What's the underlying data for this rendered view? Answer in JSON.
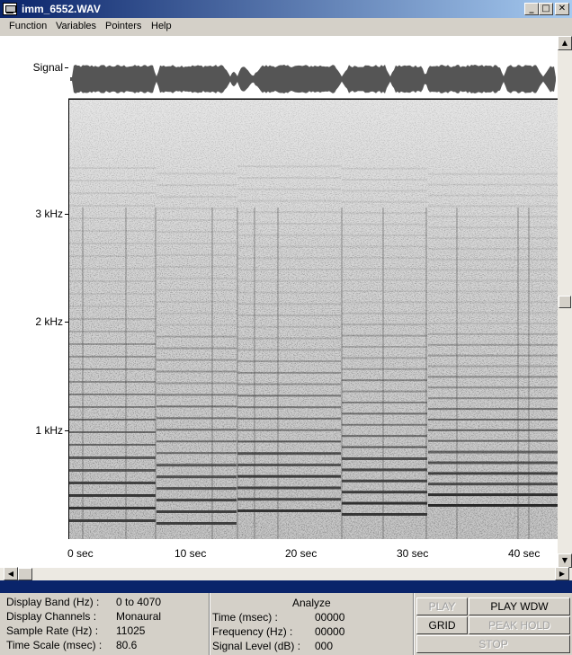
{
  "window": {
    "title": "imm_6552.WAV",
    "buttons": {
      "minimize": "_",
      "maximize": "□",
      "close": "✕"
    }
  },
  "menu": {
    "items": [
      "Function",
      "Variables",
      "Pointers",
      "Help"
    ]
  },
  "display": {
    "signal_label": "Signal",
    "y_axis_labels": [
      "3 kHz",
      "2 kHz",
      "1 kHz"
    ],
    "x_axis_labels": [
      "0 sec",
      "10 sec",
      "20 sec",
      "30 sec",
      "40 sec"
    ]
  },
  "info": {
    "display_band_label": "Display Band (Hz) :",
    "display_band_value": "0 to 4070",
    "display_channels_label": "Display Channels :",
    "display_channels_value": "Monaural",
    "sample_rate_label": "Sample Rate (Hz) :",
    "sample_rate_value": "11025",
    "time_scale_label": "Time Scale (msec) :",
    "time_scale_value": "80.6"
  },
  "analyze": {
    "title": "Analyze",
    "time_label": "Time (msec) :",
    "time_value": "00000",
    "frequency_label": "Frequency (Hz) :",
    "frequency_value": "00000",
    "signal_level_label": "Signal Level (dB) :",
    "signal_level_value": "000"
  },
  "controls": {
    "play": "PLAY",
    "play_wdw": "PLAY WDW",
    "grid": "GRID",
    "peak_hold": "PEAK HOLD",
    "stop": "STOP"
  },
  "icons": {
    "scroll_up": "scroll-up-arrow-icon",
    "scroll_down": "scroll-down-arrow-icon",
    "scroll_left": "scroll-left-arrow-icon",
    "scroll_right": "scroll-right-arrow-icon"
  }
}
